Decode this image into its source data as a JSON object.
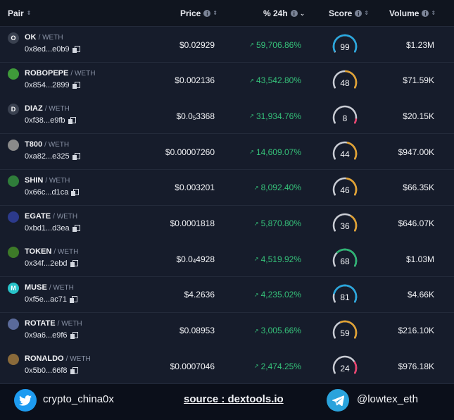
{
  "header": {
    "pair": "Pair",
    "price": "Price",
    "change": "% 24h",
    "score": "Score",
    "volume": "Volume"
  },
  "colors": {
    "positive": "#36c27a",
    "score_high": "#27a8e0",
    "score_mid": "#e3a230",
    "score_green": "#2bb673",
    "score_low": "#ea3e6b"
  },
  "rows": [
    {
      "symbol": "OK",
      "quote": "/ WETH",
      "address": "0x8ed...e0b9",
      "price": "$0.02929",
      "price_parts": null,
      "change": "59,706.86%",
      "score": 99,
      "volume": "$1.23M",
      "icon": "letter-o-icon",
      "icon_text": "O",
      "icon_color": "#3a4150"
    },
    {
      "symbol": "ROBOPEPE",
      "quote": "/ WETH",
      "address": "0x854...2899",
      "price": "$0.002136",
      "price_parts": null,
      "change": "43,542.80%",
      "score": 48,
      "volume": "$71.59K",
      "icon": "frog-icon",
      "icon_text": "",
      "icon_color": "#3f9a3a"
    },
    {
      "symbol": "DIAZ",
      "quote": "/ WETH",
      "address": "0xf38...e9fb",
      "price": "$0.0₅3368",
      "price_parts": [
        "$0.0",
        "5",
        "3368"
      ],
      "change": "31,934.76%",
      "score": 8,
      "volume": "$20.15K",
      "icon": "letter-d-icon",
      "icon_text": "D",
      "icon_color": "#3a4150"
    },
    {
      "symbol": "T800",
      "quote": "/ WETH",
      "address": "0xa82...e325",
      "price": "$0.00007260",
      "price_parts": null,
      "change": "14,609.07%",
      "score": 44,
      "volume": "$947.00K",
      "icon": "robot-icon",
      "icon_text": "",
      "icon_color": "#8a8a8a"
    },
    {
      "symbol": "SHIN",
      "quote": "/ WETH",
      "address": "0x66c...d1ca",
      "price": "$0.003201",
      "price_parts": null,
      "change": "8,092.40%",
      "score": 46,
      "volume": "$66.35K",
      "icon": "character-icon",
      "icon_text": "",
      "icon_color": "#2f7d3a"
    },
    {
      "symbol": "EGATE",
      "quote": "/ WETH",
      "address": "0xbd1...d3ea",
      "price": "$0.0001818",
      "price_parts": null,
      "change": "5,870.80%",
      "score": 36,
      "volume": "$646.07K",
      "icon": "gate-icon",
      "icon_text": "",
      "icon_color": "#2c3a8c"
    },
    {
      "symbol": "TOKEN",
      "quote": "/ WETH",
      "address": "0x34f...2ebd",
      "price": "$0.0₄4928",
      "price_parts": [
        "$0.0",
        "4",
        "4928"
      ],
      "change": "4,519.92%",
      "score": 68,
      "volume": "$1.03M",
      "icon": "leaf-icon",
      "icon_text": "",
      "icon_color": "#3d7a28"
    },
    {
      "symbol": "MUSE",
      "quote": "/ WETH",
      "address": "0xf5e...ac71",
      "price": "$4.2636",
      "price_parts": null,
      "change": "4,235.02%",
      "score": 81,
      "volume": "$4.66K",
      "icon": "muse-icon",
      "icon_text": "M",
      "icon_color": "#27c3c9"
    },
    {
      "symbol": "ROTATE",
      "quote": "/ WETH",
      "address": "0x9a6...e9f6",
      "price": "$0.08953",
      "price_parts": null,
      "change": "3,005.66%",
      "score": 59,
      "volume": "$216.10K",
      "icon": "globe-icon",
      "icon_text": "",
      "icon_color": "#5a6a9a"
    },
    {
      "symbol": "RONALDO",
      "quote": "/ WETH",
      "address": "0x5b0...66f8",
      "price": "$0.0007046",
      "price_parts": null,
      "change": "2,474.25%",
      "score": 24,
      "volume": "$976.18K",
      "icon": "player-icon",
      "icon_text": "",
      "icon_color": "#8a6a3a"
    }
  ],
  "footer": {
    "twitter_handle": "crypto_china0x",
    "source": "source : dextools.io",
    "telegram_handle": "@lowtex_eth"
  }
}
